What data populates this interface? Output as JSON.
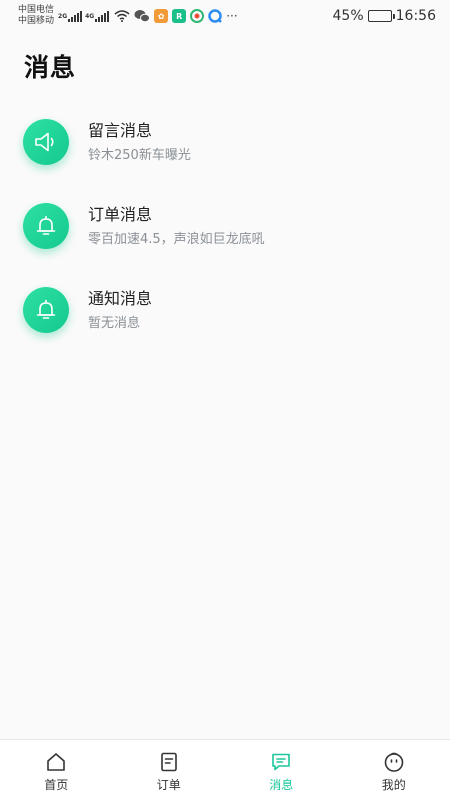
{
  "status_bar": {
    "carrier_1": "中国电信",
    "carrier_2": "中国移动",
    "net_1": "2G",
    "net_2": "4G",
    "more": "···",
    "battery_percent": "45%",
    "battery_level": 0.45,
    "time": "16:56"
  },
  "page": {
    "title": "消息"
  },
  "messages": [
    {
      "title": "留言消息",
      "subtitle": "铃木250新车曝光",
      "icon": "speaker-icon"
    },
    {
      "title": "订单消息",
      "subtitle": "零百加速4.5，声浪如巨龙底吼",
      "icon": "bell-icon"
    },
    {
      "title": "通知消息",
      "subtitle": "暂无消息",
      "icon": "bell-icon"
    }
  ],
  "nav": {
    "items": [
      {
        "label": "首页",
        "icon": "home-icon"
      },
      {
        "label": "订单",
        "icon": "order-icon"
      },
      {
        "label": "消息",
        "icon": "message-icon",
        "active": true
      },
      {
        "label": "我的",
        "icon": "profile-icon"
      }
    ]
  },
  "colors": {
    "accent": "#19c79a",
    "icon_bg": "#1fd69a"
  }
}
